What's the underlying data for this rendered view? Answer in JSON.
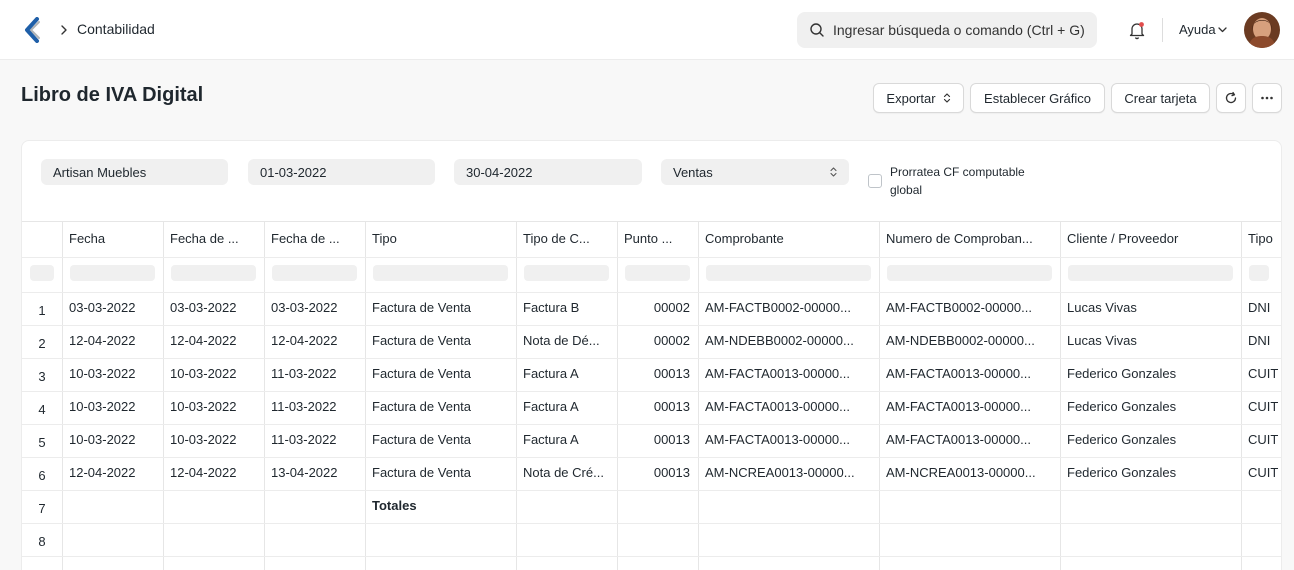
{
  "nav": {
    "breadcrumb": "Contabilidad",
    "search_placeholder": "Ingresar búsqueda o comando (Ctrl + G)",
    "help_label": "Ayuda",
    "accent_color": "#2490ef"
  },
  "page": {
    "title": "Libro de IVA Digital",
    "buttons": {
      "export": "Exportar",
      "set_chart": "Establecer Gráfico",
      "create_card": "Crear tarjeta"
    }
  },
  "filters": {
    "company": "Artisan Muebles",
    "from_date": "01-03-2022",
    "to_date": "30-04-2022",
    "type": "Ventas",
    "checkbox_label": "Prorratea CF computable global",
    "checkbox_checked": false
  },
  "table": {
    "columns": [
      "Fecha",
      "Fecha de ...",
      "Fecha de ...",
      "Tipo",
      "Tipo de C...",
      "Punto ...",
      "Comprobante",
      "Numero de Comproban...",
      "Cliente / Proveedor",
      "Tipo"
    ],
    "rows": [
      {
        "num": "1",
        "c": [
          "03-03-2022",
          "03-03-2022",
          "03-03-2022",
          "Factura de Venta",
          "Factura B",
          "00002",
          "AM-FACTB0002-00000...",
          "AM-FACTB0002-00000...",
          "Lucas Vivas",
          "DNI"
        ]
      },
      {
        "num": "2",
        "c": [
          "12-04-2022",
          "12-04-2022",
          "12-04-2022",
          "Factura de Venta",
          "Nota de Dé...",
          "00002",
          "AM-NDEBB0002-00000...",
          "AM-NDEBB0002-00000...",
          "Lucas Vivas",
          "DNI"
        ]
      },
      {
        "num": "3",
        "c": [
          "10-03-2022",
          "10-03-2022",
          "11-03-2022",
          "Factura de Venta",
          "Factura A",
          "00013",
          "AM-FACTA0013-00000...",
          "AM-FACTA0013-00000...",
          "Federico Gonzales",
          "CUIT"
        ]
      },
      {
        "num": "4",
        "c": [
          "10-03-2022",
          "10-03-2022",
          "11-03-2022",
          "Factura de Venta",
          "Factura A",
          "00013",
          "AM-FACTA0013-00000...",
          "AM-FACTA0013-00000...",
          "Federico Gonzales",
          "CUIT"
        ]
      },
      {
        "num": "5",
        "c": [
          "10-03-2022",
          "10-03-2022",
          "11-03-2022",
          "Factura de Venta",
          "Factura A",
          "00013",
          "AM-FACTA0013-00000...",
          "AM-FACTA0013-00000...",
          "Federico Gonzales",
          "CUIT"
        ]
      },
      {
        "num": "6",
        "c": [
          "12-04-2022",
          "12-04-2022",
          "13-04-2022",
          "Factura de Venta",
          "Nota de Cré...",
          "00013",
          "AM-NCREA0013-00000...",
          "AM-NCREA0013-00000...",
          "Federico Gonzales",
          "CUIT"
        ]
      },
      {
        "num": "7",
        "c": [
          "",
          "",
          "",
          "Totales",
          "",
          "",
          "",
          "",
          "",
          ""
        ]
      },
      {
        "num": "8",
        "c": [
          "",
          "",
          "",
          "",
          "",
          "",
          "",
          "",
          "",
          ""
        ]
      }
    ]
  }
}
